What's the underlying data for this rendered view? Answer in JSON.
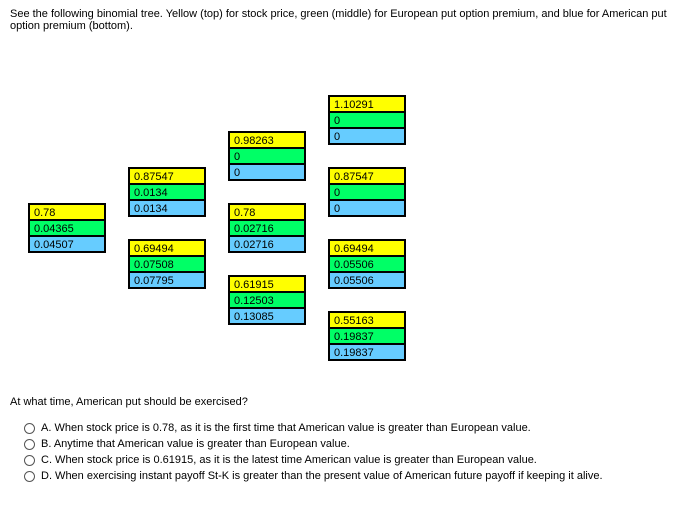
{
  "instruction": "See the following binomial tree. Yellow (top) for stock price, green (middle) for European put option premium, and blue for American put option premium (bottom).",
  "question": "At what time, American put should be exercised?",
  "options": {
    "a": "A. When stock price is 0.78, as it is the first time that American value is greater than European value.",
    "b": "B. Anytime that American value is greater than European value.",
    "c": "C. When stock price is 0.61915, as it is the latest time American value is greater than European value.",
    "d": "D. When exercising instant payoff St-K is greater than the present value of American future payoff if keeping it alive."
  },
  "tree": {
    "t0_root": {
      "stock": "0.78",
      "eu": "0.04365",
      "am": "0.04507"
    },
    "t1_up": {
      "stock": "0.87547",
      "eu": "0.0134",
      "am": "0.0134"
    },
    "t1_dn": {
      "stock": "0.69494",
      "eu": "0.07508",
      "am": "0.07795"
    },
    "t2_uu": {
      "stock": "0.98263",
      "eu": "0",
      "am": "0"
    },
    "t2_ud": {
      "stock": "0.78",
      "eu": "0.02716",
      "am": "0.02716"
    },
    "t2_dd": {
      "stock": "0.61915",
      "eu": "0.12503",
      "am": "0.13085"
    },
    "t3_uuu": {
      "stock": "1.10291",
      "eu": "0",
      "am": "0"
    },
    "t3_uud": {
      "stock": "0.87547",
      "eu": "0",
      "am": "0"
    },
    "t3_udd": {
      "stock": "0.69494",
      "eu": "0.05506",
      "am": "0.05506"
    },
    "t3_ddd": {
      "stock": "0.55163",
      "eu": "0.19837",
      "am": "0.19837"
    }
  }
}
